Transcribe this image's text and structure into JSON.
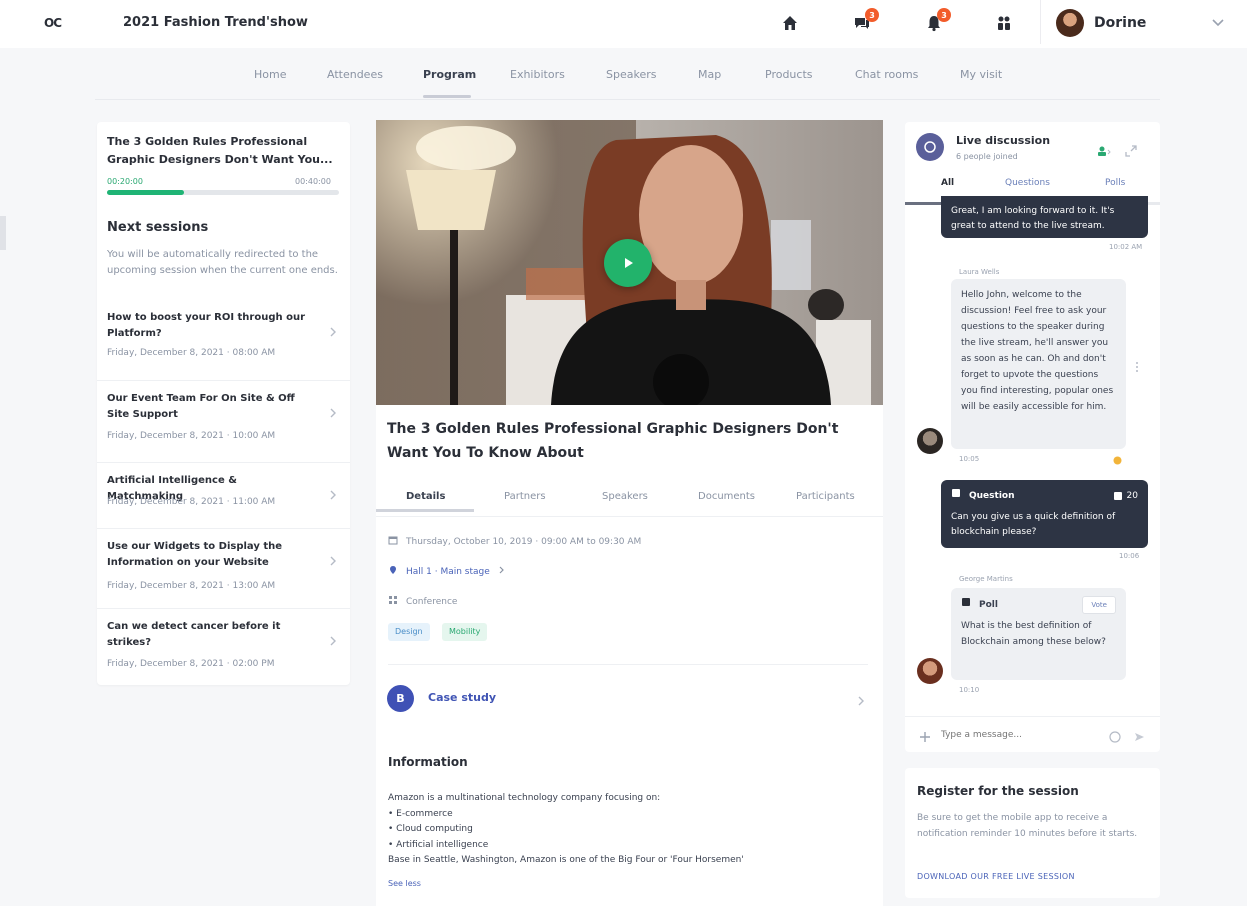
{
  "topbar": {
    "logo": "OC",
    "event_title": "2021 Fashion Trend'show",
    "icons": [
      "home-icon",
      "chat-icon",
      "bell-icon",
      "people-icon"
    ],
    "chat_badge": "3",
    "bell_badge": "3",
    "user_name": "Dorine"
  },
  "nav": {
    "items": [
      "Home",
      "Attendees",
      "Program",
      "Exhibitors",
      "Speakers",
      "Map",
      "Products",
      "Chat rooms",
      "My visit"
    ],
    "active": "Program"
  },
  "left": {
    "current_title": "The 3 Golden Rules Professional Graphic Designers Don't Want You...",
    "time_start": "00:20:00",
    "time_end": "00:40:00",
    "progress": 0.33,
    "next_heading": "Next sessions",
    "next_desc": "You will be automatically redirected to the upcoming session when the current one ends.",
    "sessions": [
      {
        "title": "How to boost your ROI through our Platform?",
        "date": "Friday, December 8, 2021 · 08:00 AM"
      },
      {
        "title": "Our Event Team For On Site & Off Site Support",
        "date": "Friday, December 8, 2021 · 10:00 AM"
      },
      {
        "title": "Artificial Intelligence & Matchmaking",
        "date": "Friday, December 8, 2021 · 11:00 AM"
      },
      {
        "title": "Use our Widgets to Display the Information on your Website",
        "date": "Friday, December 8, 2021 · 13:00 AM"
      },
      {
        "title": "Can we detect cancer before it strikes?",
        "date": "Friday, December 8, 2021 · 02:00 PM"
      }
    ]
  },
  "center": {
    "talk_title": "The 3 Golden Rules Professional Graphic Designers Don't Want You To Know About",
    "tabs": [
      "Details",
      "Partners",
      "Speakers",
      "Documents",
      "Participants"
    ],
    "active_tab": "Details",
    "datetime": "Thursday, October 10, 2019 · 09:00 AM to 09:30 AM",
    "location": "Hall 1 · Main stage",
    "type": "Conference",
    "tags": [
      "Design",
      "Mobility"
    ],
    "case_badge": "B",
    "case_label": "Case study",
    "info_heading": "Information",
    "info_lines": [
      "Amazon is a multinational technology company focusing on:",
      "• E-commerce",
      "• Cloud computing",
      "• Artificial intelligence",
      "Base in Seattle, Washington, Amazon is one of the Big Four or 'Four Horsemen'"
    ],
    "see_less": "See less"
  },
  "chat": {
    "title": "Live discussion",
    "subtitle": "6 people joined",
    "tabs": [
      "All",
      "Questions",
      "Polls"
    ],
    "active_tab": "All",
    "msg1_text": "Great, I am looking forward to it. It's great to attend to the live stream.",
    "msg1_time": "10:02 AM",
    "msg2_author": "Laura Wells",
    "msg2_text": "Hello John, welcome to the discussion! Feel free to ask your questions to the speaker during the live stream, he'll answer you as soon as he can. Oh and don't forget to upvote the questions you find interesting, popular ones will be easily accessible for him.",
    "msg2_time": "10:05",
    "msg3_label": "Question",
    "msg3_votes": "20",
    "msg3_text": "Can you give us a quick definition of blockchain please?",
    "msg3_time": "10:06",
    "msg4_author": "George Martins",
    "msg4_label": "Poll",
    "msg4_btn": "Vote",
    "msg4_text": "What is the best definition of Blockchain among these below?",
    "msg4_time": "10:10",
    "input_placeholder": "Type a message..."
  },
  "register": {
    "title": "Register for the session",
    "desc": "Be sure to get the mobile app to receive a notification reminder 10 minutes before it starts.",
    "link": "DOWNLOAD OUR FREE LIVE SESSION"
  }
}
